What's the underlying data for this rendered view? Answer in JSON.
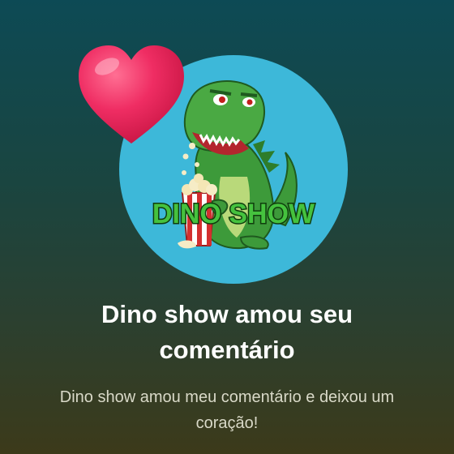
{
  "notification": {
    "title": "Dino show amou seu comentário",
    "subtitle": "Dino show amou meu comentário e deixou um coração!",
    "avatar_label": "DINO SHOW"
  },
  "colors": {
    "avatar_bg": "#3db8d9",
    "heart": "#e8245a",
    "dino_green": "#3d9a3a",
    "logo_text": "#3fb33a"
  },
  "icons": {
    "reaction": "heart-icon",
    "avatar": "dino-show-avatar"
  }
}
